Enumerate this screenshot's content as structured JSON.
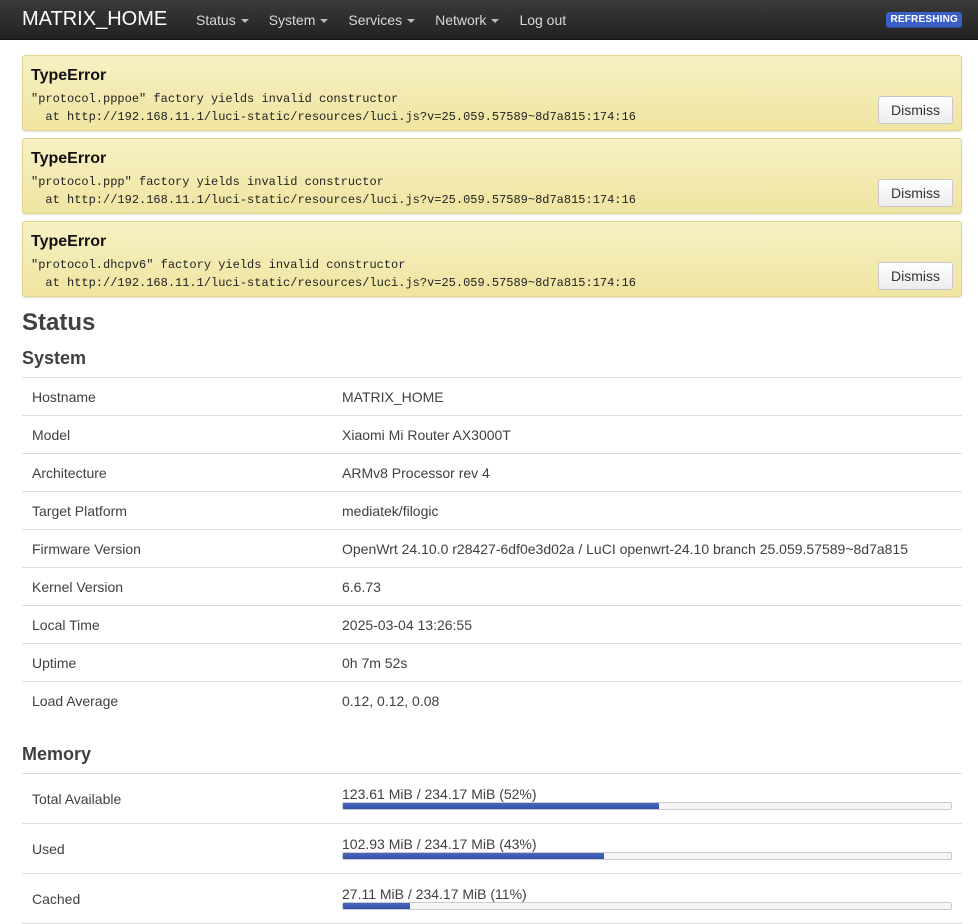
{
  "navbar": {
    "brand": "MATRIX_HOME",
    "menu": [
      {
        "label": "Status",
        "dropdown": true
      },
      {
        "label": "System",
        "dropdown": true
      },
      {
        "label": "Services",
        "dropdown": true
      },
      {
        "label": "Network",
        "dropdown": true
      },
      {
        "label": "Log out",
        "dropdown": false
      }
    ],
    "badge": "REFRESHING"
  },
  "alerts": [
    {
      "title": "TypeError",
      "message": "\"protocol.pppoe\" factory yields invalid constructor",
      "trace": "  at http://192.168.11.1/luci-static/resources/luci.js?v=25.059.57589~8d7a815:174:16",
      "button": "Dismiss"
    },
    {
      "title": "TypeError",
      "message": "\"protocol.ppp\" factory yields invalid constructor",
      "trace": "  at http://192.168.11.1/luci-static/resources/luci.js?v=25.059.57589~8d7a815:174:16",
      "button": "Dismiss"
    },
    {
      "title": "TypeError",
      "message": "\"protocol.dhcpv6\" factory yields invalid constructor",
      "trace": "  at http://192.168.11.1/luci-static/resources/luci.js?v=25.059.57589~8d7a815:174:16",
      "button": "Dismiss"
    }
  ],
  "page": {
    "title": "Status"
  },
  "system": {
    "title": "System",
    "rows": [
      {
        "key": "Hostname",
        "value": "MATRIX_HOME"
      },
      {
        "key": "Model",
        "value": "Xiaomi Mi Router AX3000T"
      },
      {
        "key": "Architecture",
        "value": "ARMv8 Processor rev 4"
      },
      {
        "key": "Target Platform",
        "value": "mediatek/filogic"
      },
      {
        "key": "Firmware Version",
        "value": "OpenWrt 24.10.0 r28427-6df0e3d02a / LuCI openwrt-24.10 branch 25.059.57589~8d7a815"
      },
      {
        "key": "Kernel Version",
        "value": "6.6.73"
      },
      {
        "key": "Local Time",
        "value": "2025-03-04 13:26:55"
      },
      {
        "key": "Uptime",
        "value": "0h 7m 52s"
      },
      {
        "key": "Load Average",
        "value": "0.12, 0.12, 0.08"
      }
    ]
  },
  "memory": {
    "title": "Memory",
    "rows": [
      {
        "key": "Total Available",
        "text": "123.61 MiB / 234.17 MiB (52%)",
        "percent": 52
      },
      {
        "key": "Used",
        "text": "102.93 MiB / 234.17 MiB (43%)",
        "percent": 43
      },
      {
        "key": "Cached",
        "text": "27.11 MiB / 234.17 MiB (11%)",
        "percent": 11
      }
    ]
  },
  "colors": {
    "navbar_bg": "#2b2b2b",
    "badge_bg": "#3a5fc7",
    "alert_bg": "#f3ebb5",
    "progress_fill": "#3f5cb8"
  }
}
